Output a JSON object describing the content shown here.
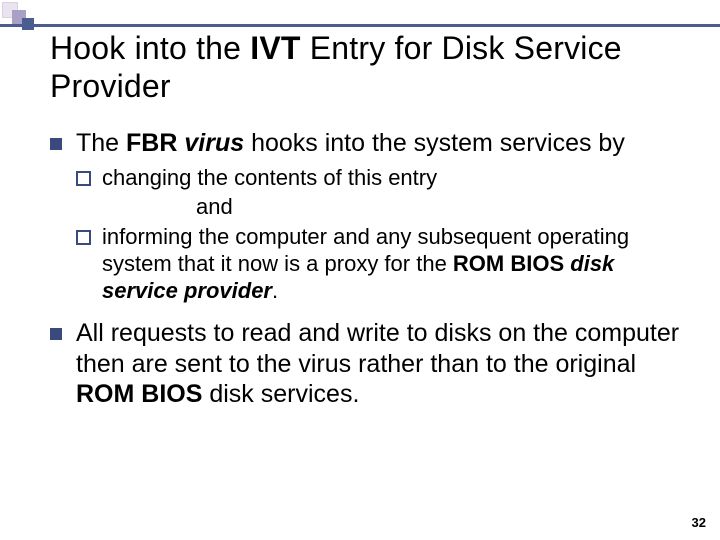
{
  "title": {
    "pre": "Hook into the ",
    "bold1": "IVT",
    "mid": " Entry for Disk Service Provider"
  },
  "bullet1": {
    "p1": "The ",
    "b1": "FBR ",
    "bi1": "virus",
    "p2": " hooks into the system services by"
  },
  "sub1": {
    "p1": "changing the contents of this entry"
  },
  "subAnd": "and",
  "sub2": {
    "p1": "informing the computer and any subsequent operating system that it now is a proxy for the ",
    "b1": "ROM BIOS ",
    "bi1": "disk service provider",
    "p2": "."
  },
  "bullet2": {
    "p1": "All requests to read and write to disks on the computer then are sent to the virus rather than to the original ",
    "b1": "ROM BIOS",
    "p2": " disk services."
  },
  "pageNumber": "32"
}
